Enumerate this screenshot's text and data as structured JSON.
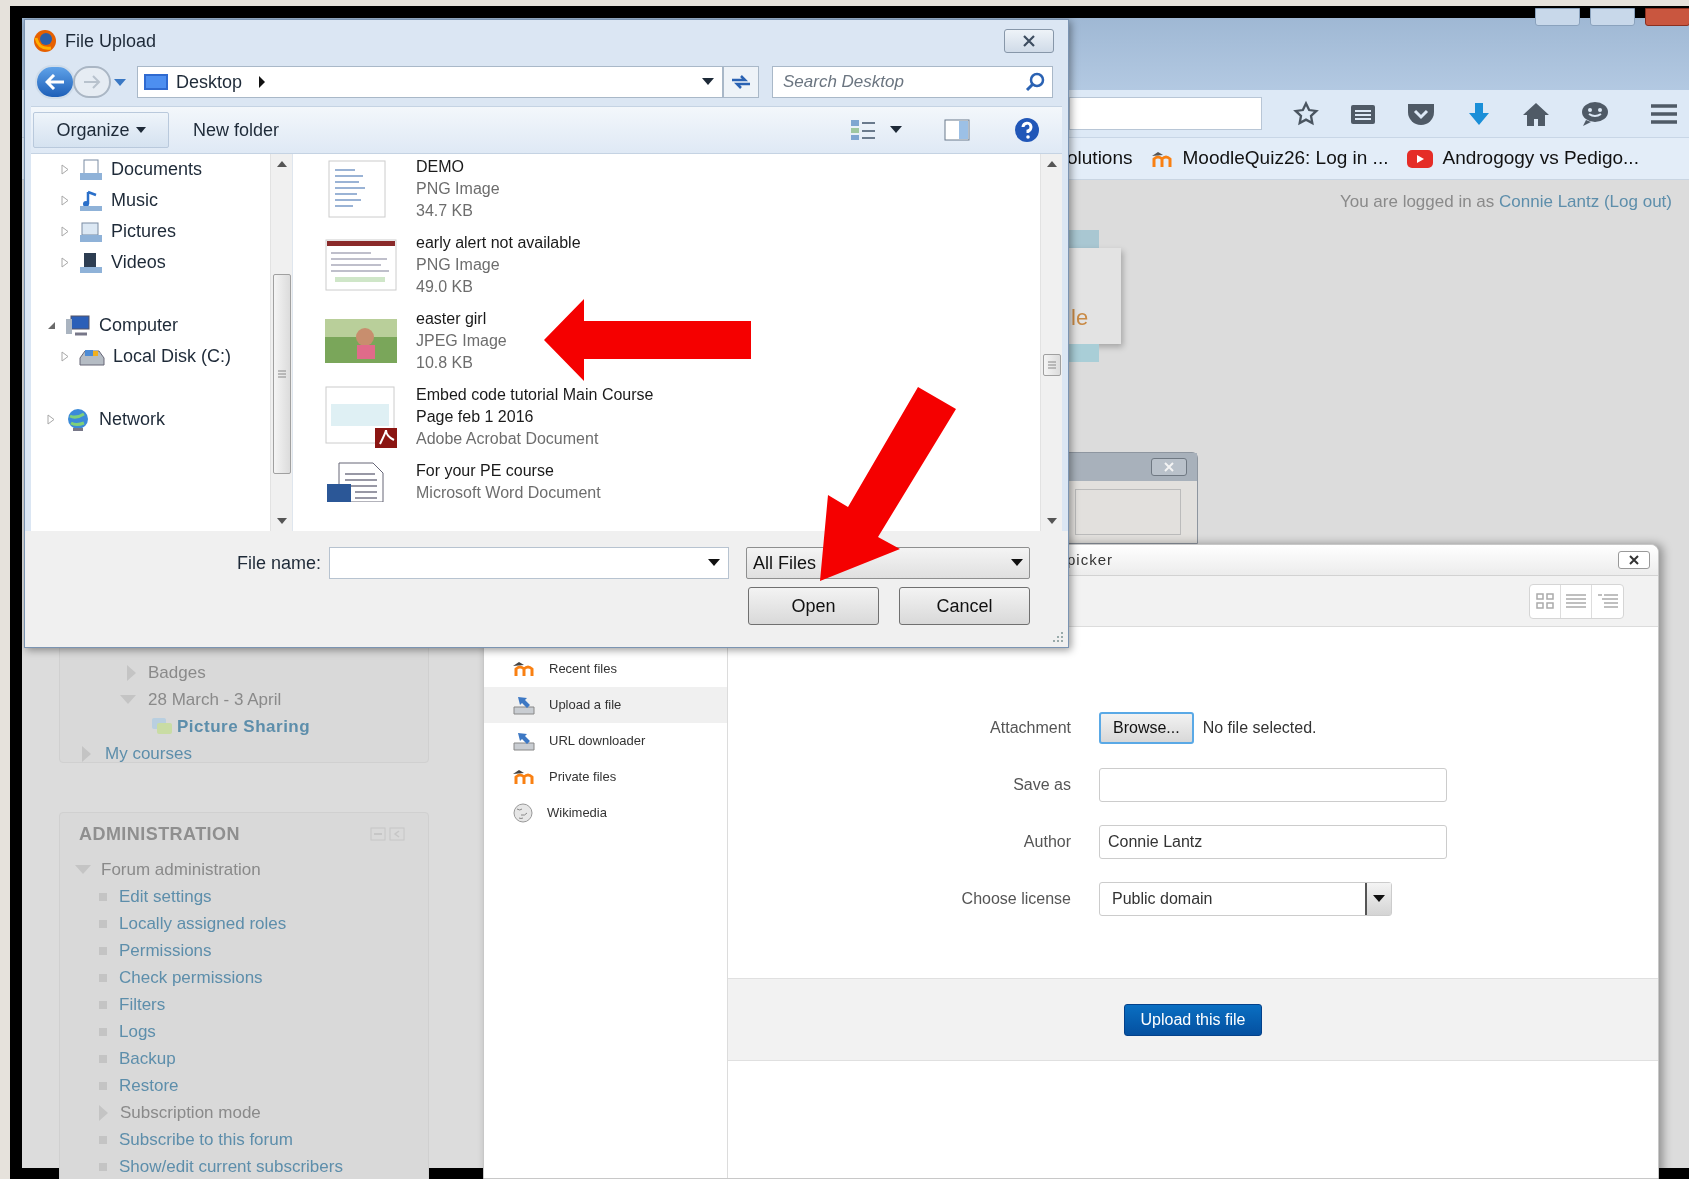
{
  "browser": {
    "bookmarks": [
      {
        "label": "olutions"
      },
      {
        "label": "MoodleQuiz26: Log in ..."
      },
      {
        "label": "Androgogy vs Pedigo..."
      }
    ],
    "login": {
      "prefix": "You are logged in as",
      "user": "Connie Lantz",
      "logout": "(Log out)"
    }
  },
  "logo_fragment": "le",
  "navigation": {
    "course_items": [
      {
        "label": "Badges",
        "expanded": false
      },
      {
        "label": "28 March - 3 April",
        "expanded": true,
        "children": [
          {
            "label": "Picture Sharing"
          }
        ]
      }
    ],
    "top_items": [
      {
        "label": "My courses",
        "expanded": false
      }
    ]
  },
  "administration": {
    "title": "ADMINISTRATION",
    "section": {
      "label": "Forum administration",
      "expanded": true,
      "children": [
        {
          "label": "Edit settings",
          "kind": "link"
        },
        {
          "label": "Locally assigned roles",
          "kind": "link"
        },
        {
          "label": "Permissions",
          "kind": "link"
        },
        {
          "label": "Check permissions",
          "kind": "link"
        },
        {
          "label": "Filters",
          "kind": "link"
        },
        {
          "label": "Logs",
          "kind": "link"
        },
        {
          "label": "Backup",
          "kind": "link"
        },
        {
          "label": "Restore",
          "kind": "link"
        },
        {
          "label": "Subscription mode",
          "kind": "branch"
        },
        {
          "label": "Subscribe to this forum",
          "kind": "link"
        },
        {
          "label": "Show/edit current subscribers",
          "kind": "link"
        }
      ]
    }
  },
  "file_picker": {
    "title": "picker",
    "repositories": [
      {
        "label": "Recent files",
        "selected": false
      },
      {
        "label": "Upload a file",
        "selected": true
      },
      {
        "label": "URL downloader",
        "selected": false
      },
      {
        "label": "Private files",
        "selected": false
      },
      {
        "label": "Wikimedia",
        "selected": false
      }
    ],
    "form": {
      "attachment": {
        "label": "Attachment",
        "button": "Browse...",
        "status": "No file selected."
      },
      "save_as": {
        "label": "Save as"
      },
      "author": {
        "label": "Author",
        "value": "Connie Lantz"
      },
      "license": {
        "label": "Choose license",
        "value": "Public domain"
      }
    },
    "submit": "Upload this file"
  },
  "file_dialog": {
    "title": "File Upload",
    "location": "Desktop",
    "search_placeholder": "Search Desktop",
    "organize": "Organize",
    "new_folder": "New folder",
    "libraries": [
      {
        "label": "Documents",
        "expanded": false
      },
      {
        "label": "Music",
        "expanded": false
      },
      {
        "label": "Pictures",
        "expanded": false
      },
      {
        "label": "Videos",
        "expanded": false
      }
    ],
    "nav_tree": [
      {
        "label": "Computer",
        "expanded": true,
        "children": [
          {
            "label": "Local Disk (C:)",
            "expanded": false
          }
        ]
      },
      {
        "label": "Network",
        "expanded": false
      }
    ],
    "files": [
      {
        "name": "DEMO",
        "type": "PNG Image",
        "size": "34.7 KB"
      },
      {
        "name": "early alert not available",
        "type": "PNG Image",
        "size": "49.0 KB"
      },
      {
        "name": "easter girl",
        "type": "JPEG Image",
        "size": "10.8 KB"
      },
      {
        "name": "Embed code tutorial Main Course Page feb 1 2016",
        "type": "Adobe Acrobat Document"
      },
      {
        "name": "For your PE course",
        "type": "Microsoft Word Document"
      }
    ],
    "file_name_label": "File name:",
    "file_type": "All Files",
    "buttons": [
      "Open",
      "Cancel"
    ]
  }
}
